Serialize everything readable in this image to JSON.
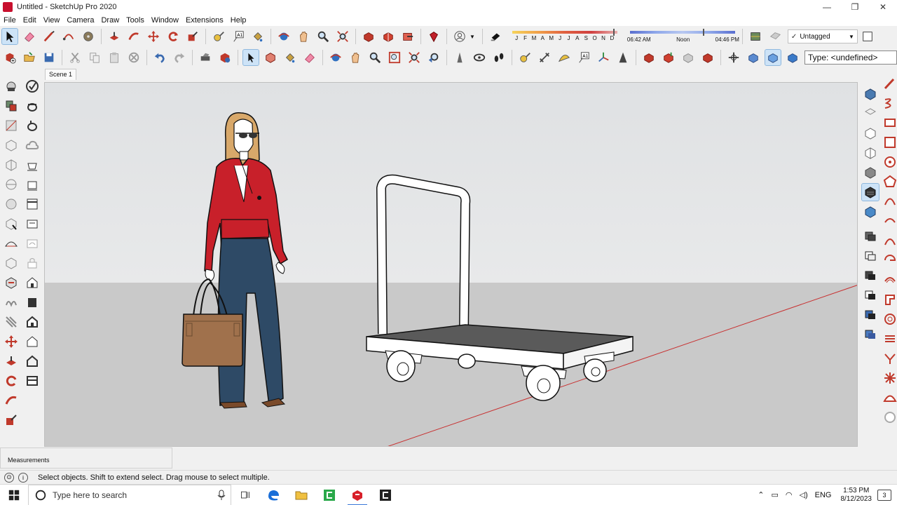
{
  "window": {
    "title": "Untitled - SketchUp Pro 2020",
    "controls": [
      "—",
      "❐",
      "✕"
    ]
  },
  "menu": [
    "File",
    "Edit",
    "View",
    "Camera",
    "Draw",
    "Tools",
    "Window",
    "Extensions",
    "Help"
  ],
  "shadow_settings": {
    "months": [
      "J",
      "F",
      "M",
      "A",
      "M",
      "J",
      "J",
      "A",
      "S",
      "O",
      "N",
      "D"
    ],
    "time_start": "06:42 AM",
    "time_mid": "Noon",
    "time_end": "04:46 PM"
  },
  "tag_select": {
    "value": "Untagged"
  },
  "type_input": {
    "value": "Type: <undefined>"
  },
  "scene": {
    "tab": "Scene 1"
  },
  "measurements": {
    "label": "Measurements"
  },
  "status": {
    "text": "Select objects. Shift to extend select. Drag mouse to select multiple."
  },
  "taskbar": {
    "search_placeholder": "Type here to search",
    "lang": "ENG",
    "time": "1:53 PM",
    "date": "8/12/2023",
    "notification_count": "3"
  },
  "colors": {
    "shirt": "#c8202a",
    "jeans": "#2e4a66",
    "bag": "#a0714c",
    "hair": "#d8a86a",
    "cart_deck": "#5a5a5a",
    "axis_red": "#c83030"
  }
}
